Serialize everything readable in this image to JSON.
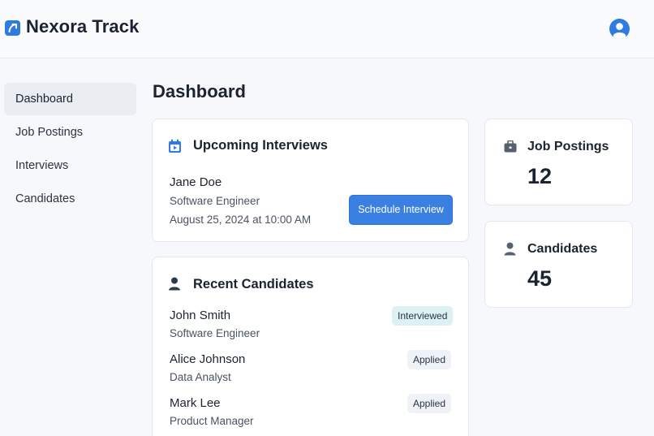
{
  "app": {
    "title": "Nexora Track"
  },
  "sidebar": {
    "items": [
      {
        "label": "Dashboard",
        "active": true
      },
      {
        "label": "Job Postings"
      },
      {
        "label": "Interviews"
      },
      {
        "label": "Candidates"
      }
    ]
  },
  "main": {
    "title": "Dashboard",
    "upcoming": {
      "title": "Upcoming Interviews",
      "icon": "calendar-icon",
      "name": "Jane Doe",
      "role": "Software Engineer",
      "datetime": "August 25, 2024 at 10:00 AM",
      "button_label": "Schedule Interview"
    },
    "recent": {
      "title": "Recent Candidates",
      "icon": "person-icon",
      "candidates": [
        {
          "name": "John Smith",
          "role": "Software Engineer",
          "status": "Interviewed"
        },
        {
          "name": "Alice Johnson",
          "role": "Data Analyst",
          "status": "Applied"
        },
        {
          "name": "Mark Lee",
          "role": "Product Manager",
          "status": "Applied"
        }
      ]
    }
  },
  "stats": {
    "job_postings": {
      "label": "Job Postings",
      "value": "12",
      "icon": "briefcase-icon"
    },
    "candidates": {
      "label": "Candidates",
      "value": "45",
      "icon": "person-icon"
    }
  },
  "colors": {
    "accent": "#3a80e3",
    "interviewed_badge": "#dcf1f3",
    "applied_badge": "#eff2f6"
  }
}
